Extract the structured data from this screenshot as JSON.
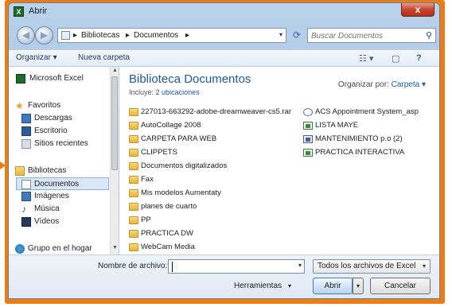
{
  "window": {
    "title": "Abrir",
    "close_glyph": "x",
    "app_icon_letter": "X"
  },
  "address": {
    "crumbs": [
      "Bibliotecas",
      "Documentos"
    ],
    "separator": "▸",
    "dropdown_glyph": "▾"
  },
  "search": {
    "placeholder": "Buscar Documentos",
    "icon": "magnifier-icon"
  },
  "toolbar": {
    "organize_label": "Organizar ▾",
    "new_folder_label": "Nueva carpeta",
    "views_glyph": "☷ ▾",
    "preview_glyph": "▢",
    "help_glyph": "?"
  },
  "sidebar": {
    "items": [
      {
        "label": "Microsoft Excel",
        "icon": "excel-icon"
      },
      {
        "label": "Favoritos",
        "icon": "star-icon"
      },
      {
        "label": "Descargas",
        "icon": "downloads-icon"
      },
      {
        "label": "Escritorio",
        "icon": "desktop-icon"
      },
      {
        "label": "Sitios recientes",
        "icon": "recent-places-icon"
      },
      {
        "label": "Bibliotecas",
        "icon": "libraries-icon"
      },
      {
        "label": "Documentos",
        "icon": "documents-icon"
      },
      {
        "label": "Imágenes",
        "icon": "pictures-icon"
      },
      {
        "label": "Música",
        "icon": "music-icon"
      },
      {
        "label": "Vídeos",
        "icon": "videos-icon"
      },
      {
        "label": "Grupo en el hogar",
        "icon": "homegroup-icon"
      }
    ],
    "selected": "Documentos"
  },
  "library": {
    "title": "Biblioteca Documentos",
    "includes_label": "Incluye:",
    "includes_link": "2 ubicaciones",
    "arrange_label": "Organizar por:",
    "arrange_value": "Carpeta ▾"
  },
  "files_col1": [
    "227013-663292-adobe-dreamweaver-cs5.rar",
    "AutoCollage 2008",
    "CARPETA PARA WEB",
    "CLIPPETS",
    "Documentos digitalizados",
    "Fax",
    "Mis modelos Aumentaty",
    "planes de cuarto",
    "PP",
    "PRACTICA DW",
    "WebCam Media"
  ],
  "files_col2": [
    "ACS Appointment System_asp",
    "LISTA MAYE",
    "MANTENIMIENTO p.o (2)",
    "PRACTICA INTERACTIVA"
  ],
  "footer": {
    "filename_label": "Nombre de archivo:",
    "filename_value": "",
    "filter_label": "Todos los archivos de Excel",
    "tools_label": "Herramientas",
    "open_label": "Abrir",
    "cancel_label": "Cancelar",
    "dropdown_glyph": "▾"
  },
  "colors": {
    "frame_orange": "#f07a12",
    "title_blue": "#1e5aa0",
    "close_red": "#c8452f",
    "folder_yellow": "#e6b540"
  }
}
